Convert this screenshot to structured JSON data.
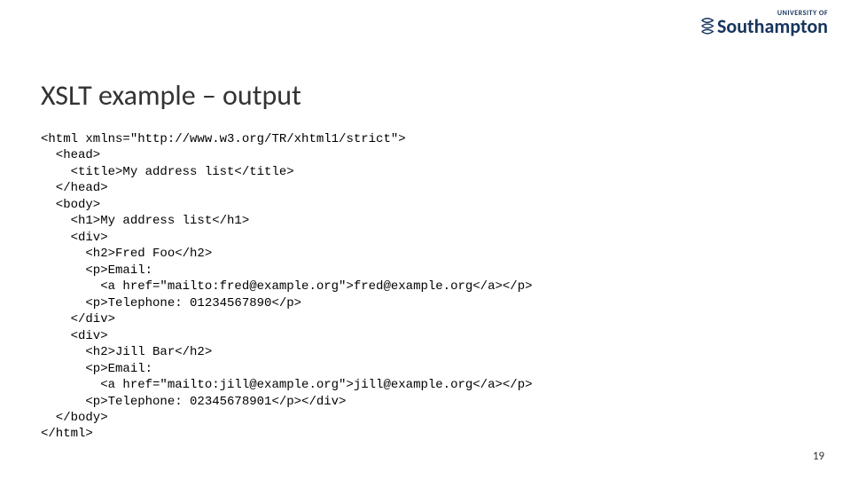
{
  "logo": {
    "top": "UNIVERSITY OF",
    "main": "Southampton"
  },
  "title": "XSLT example – output",
  "code": "<html xmlns=\"http://www.w3.org/TR/xhtml1/strict\">\n  <head>\n    <title>My address list</title>\n  </head>\n  <body>\n    <h1>My address list</h1>\n    <div>\n      <h2>Fred Foo</h2>\n      <p>Email:\n        <a href=\"mailto:fred@example.org\">fred@example.org</a></p>\n      <p>Telephone: 01234567890</p>\n    </div>\n    <div>\n      <h2>Jill Bar</h2>\n      <p>Email:\n        <a href=\"mailto:jill@example.org\">jill@example.org</a></p>\n      <p>Telephone: 02345678901</p></div>\n  </body>\n</html>",
  "pagenum": "19"
}
